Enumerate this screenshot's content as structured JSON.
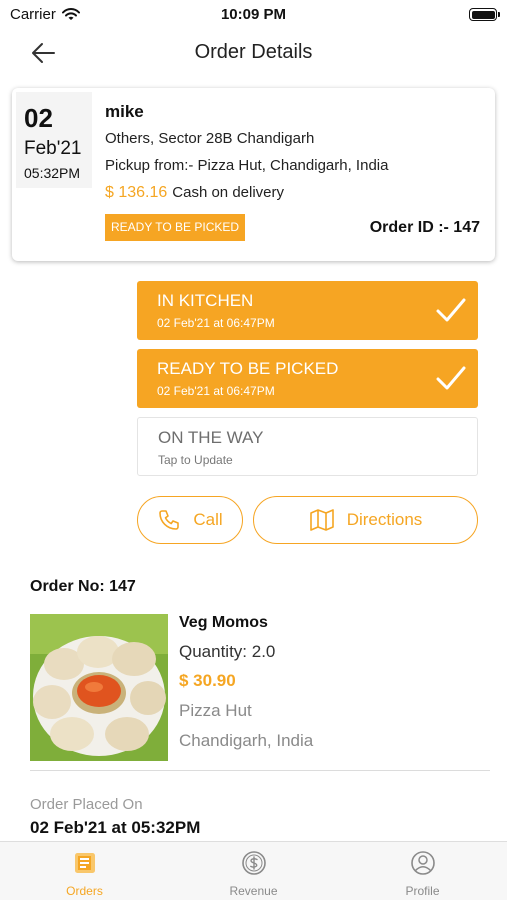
{
  "status_bar": {
    "carrier": "Carrier",
    "time": "10:09 PM"
  },
  "nav": {
    "title": "Order Details",
    "back_icon": "arrow-left-icon"
  },
  "order_card": {
    "day": "02",
    "month": "Feb'21",
    "time": "05:32PM",
    "customer_name": "mike",
    "address": "Others, Sector 28B Chandigarh",
    "pickup": "Pickup from:- Pizza Hut, Chandigarh, India",
    "amount": "$ 136.16",
    "payment_method": "Cash on delivery",
    "status_badge": "READY TO BE PICKED",
    "order_id": "Order ID :- 147"
  },
  "steps": [
    {
      "title": "IN KITCHEN",
      "subtitle": "02 Feb'21 at 06:47PM",
      "done": true
    },
    {
      "title": "READY TO BE PICKED",
      "subtitle": "02 Feb'21 at 06:47PM",
      "done": true
    },
    {
      "title": "ON THE WAY",
      "subtitle": "Tap to Update",
      "done": false
    }
  ],
  "actions": {
    "call_label": "Call",
    "directions_label": "Directions"
  },
  "order_details": {
    "order_no": "Order No: 147",
    "item": {
      "name": "Veg Momos",
      "quantity": "Quantity: 2.0",
      "price": "$ 30.90",
      "store": "Pizza Hut",
      "location": "Chandigarh, India"
    },
    "placed_label": "Order Placed On",
    "placed_value": "02 Feb'21 at 05:32PM"
  },
  "tabs": [
    {
      "label": "Orders",
      "icon": "orders-icon",
      "active": true
    },
    {
      "label": "Revenue",
      "icon": "revenue-icon",
      "active": false
    },
    {
      "label": "Profile",
      "icon": "profile-icon",
      "active": false
    }
  ],
  "colors": {
    "accent": "#f6a523",
    "text": "#111111",
    "muted": "#8a8a8a"
  }
}
